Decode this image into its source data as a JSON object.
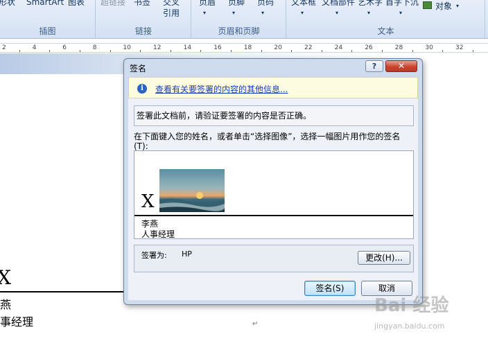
{
  "ribbon": {
    "groups": [
      {
        "label": "插图",
        "buttons": [
          "形状",
          "SmartArt",
          "图表"
        ]
      },
      {
        "label": "链接",
        "buttons": [
          "超链接",
          "书签",
          "交叉",
          "引用"
        ]
      },
      {
        "label": "页眉和页脚",
        "buttons": [
          "页眉",
          "页脚",
          "页码"
        ]
      },
      {
        "label": "文本",
        "buttons": [
          "文本框",
          "文档部件",
          "艺术字",
          "首字下沉",
          "对象"
        ]
      }
    ]
  },
  "ruler": {
    "ticks": [
      "2",
      "4",
      "6",
      "8",
      "10",
      "12",
      "14",
      "16",
      "18",
      "20",
      "22",
      "24",
      "26",
      "28",
      "30",
      "32"
    ]
  },
  "document": {
    "sig_x": "X",
    "name": "燕",
    "title": "事经理",
    "para_mark": "↵"
  },
  "dialog": {
    "title": "签名",
    "help_label": "?",
    "close_label": "✕",
    "info_link": "查看有关要签署的内容的其他信息...",
    "verify_text": "签署此文档前，请验证要签署的内容是否正确。",
    "instruction": "在下面键入您的姓名，或者单击“选择图像”，选择一幅图片用作您的签名(T):",
    "signature": {
      "x_mark": "X",
      "name": "李燕",
      "role": "人事经理"
    },
    "signing_as_label": "签署为:",
    "signing_as_value": "HP",
    "change_button": "更改(H)...",
    "sign_button": "签名(S)",
    "cancel_button": "取消"
  },
  "watermark": {
    "text": "Bai 经验",
    "url": "jingyan.baidu.com"
  }
}
